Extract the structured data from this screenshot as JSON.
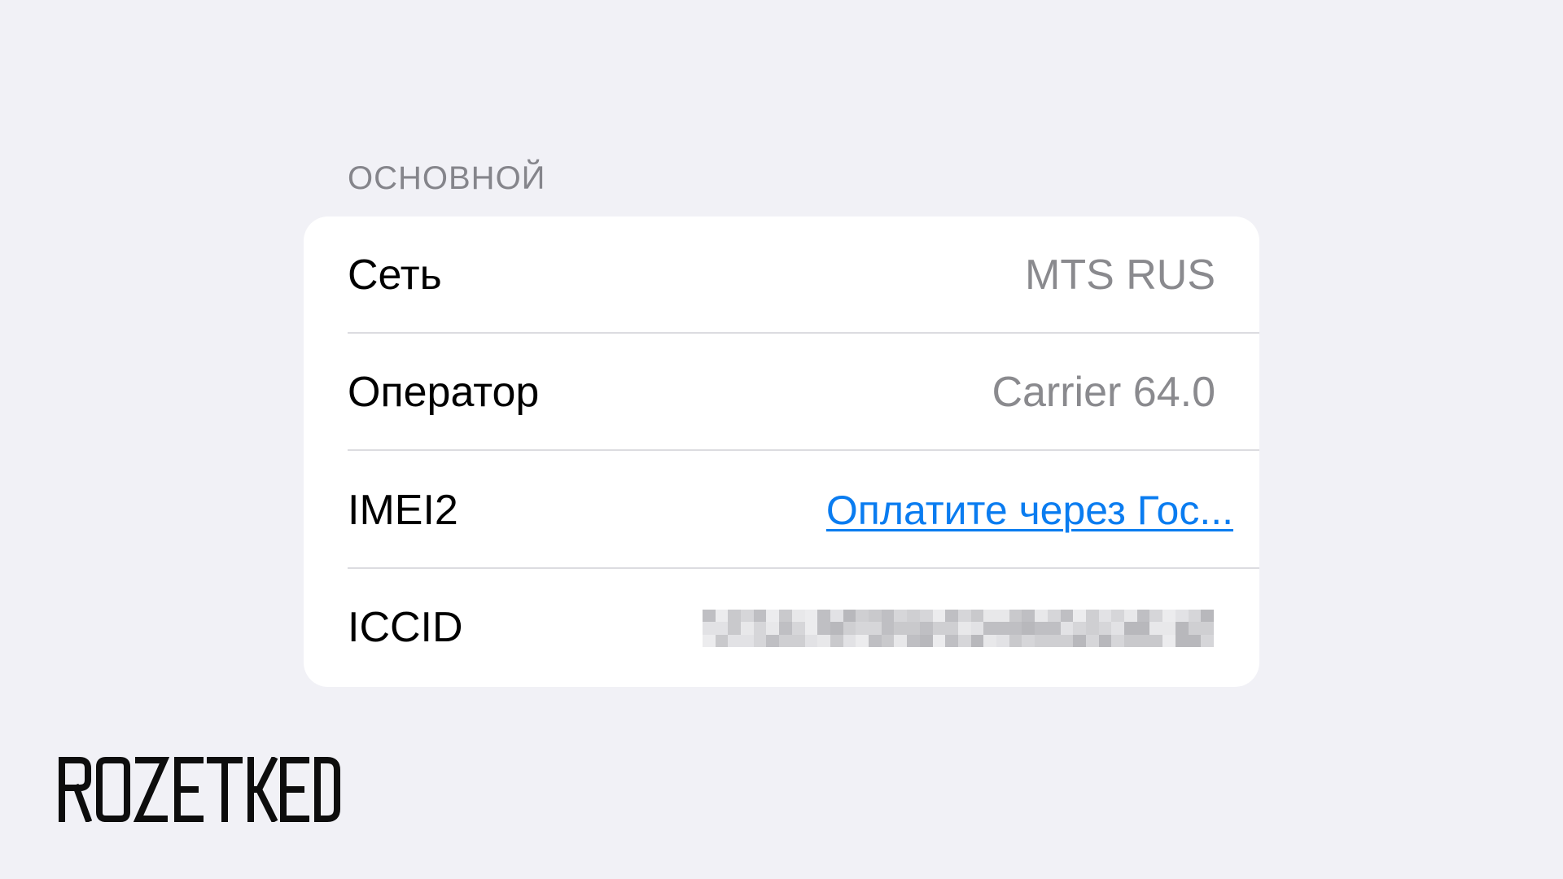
{
  "section": {
    "header": "ОСНОВНОЙ"
  },
  "rows": [
    {
      "label": "Сеть",
      "value": "MTS RUS"
    },
    {
      "label": "Оператор",
      "value": "Carrier 64.0"
    },
    {
      "label": "IMEI2",
      "value": "Оплатите через Гос..."
    },
    {
      "label": "ICCID",
      "value": ""
    }
  ],
  "logo": {
    "text": "ROZETKED"
  },
  "colors": {
    "background": "#f1f1f6",
    "card": "#ffffff",
    "link": "#0a7cf0",
    "secondary_text": "#8a8a8e",
    "header_text": "#85858b"
  }
}
